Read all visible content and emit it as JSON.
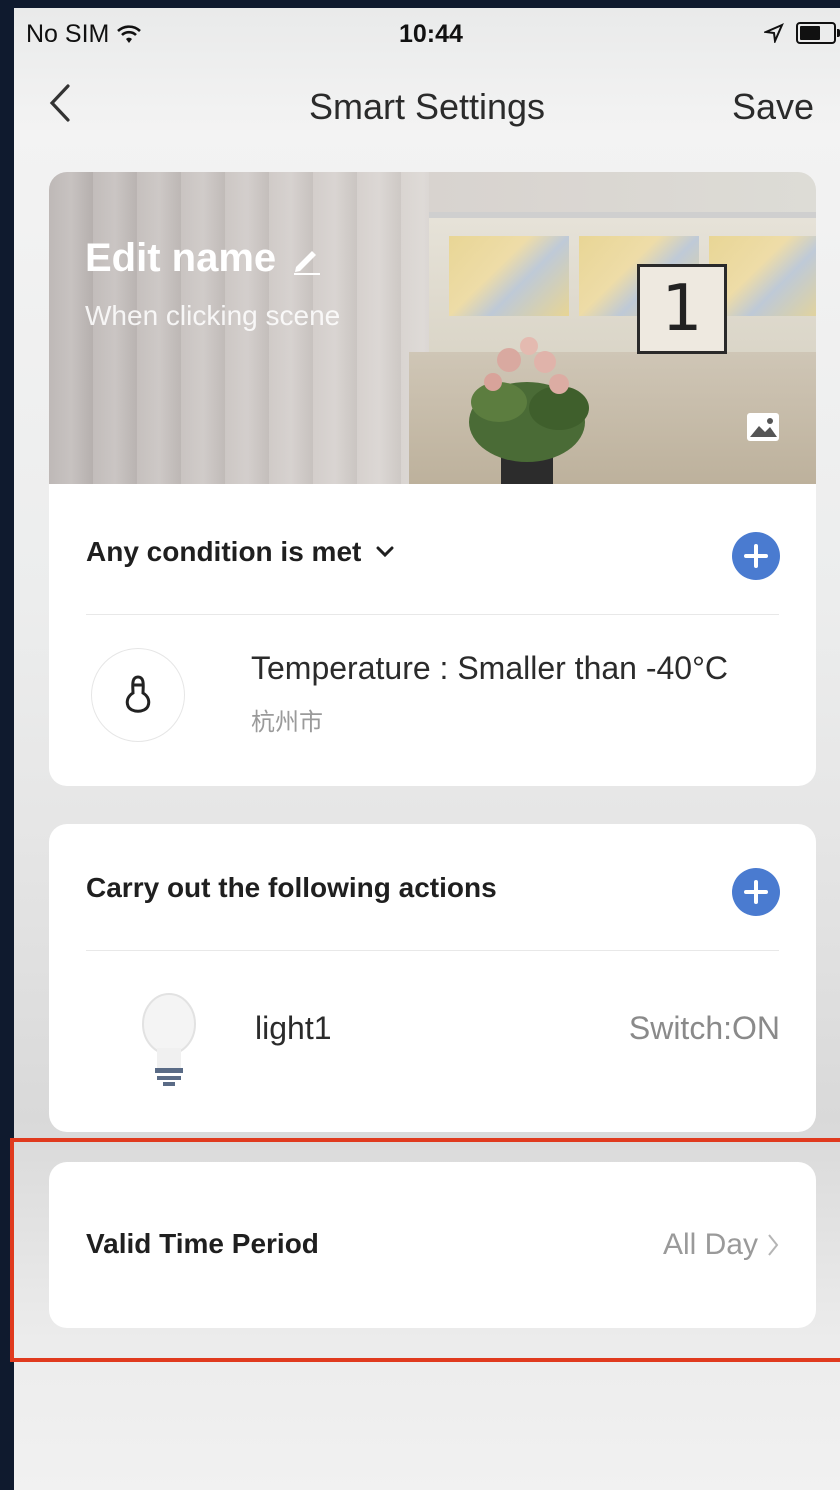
{
  "status_bar": {
    "carrier": "No SIM",
    "time": "10:44"
  },
  "nav": {
    "title": "Smart Settings",
    "save_label": "Save"
  },
  "hero": {
    "name": "Edit name",
    "subtitle": "When clicking  scene",
    "clock_digit": "1"
  },
  "condition": {
    "header": "Any condition is met",
    "item": {
      "primary": "Temperature : Smaller than -40°C",
      "secondary": "杭州市"
    }
  },
  "actions": {
    "header": "Carry out the following actions",
    "item": {
      "name": "light1",
      "value": "Switch:ON"
    }
  },
  "valid_period": {
    "label": "Valid Time Period",
    "value": "All Day"
  },
  "colors": {
    "accent": "#4a7bd0",
    "highlight": "#e03a1e"
  }
}
